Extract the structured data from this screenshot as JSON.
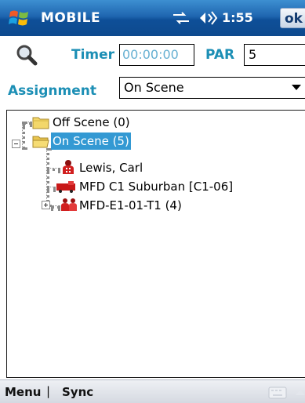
{
  "titlebar": {
    "title": "MOBILE",
    "time": "1:55",
    "ok_label": "ok",
    "icons": [
      "windows-start-icon",
      "connectivity-icon",
      "volume-icon"
    ]
  },
  "form": {
    "timer_label": "Timer",
    "timer_value": "00:00:00",
    "par_label": "PAR",
    "par_value": "5",
    "assignment_label": "Assignment",
    "assignment_value": "On Scene"
  },
  "tree": {
    "nodes": [
      {
        "label": "Off Scene (0)",
        "icon": "folder-icon",
        "depth": 0,
        "selected": false
      },
      {
        "label": "On Scene (5)",
        "icon": "folder-open-icon",
        "depth": 0,
        "selected": true,
        "expanded": true
      },
      {
        "label": "Lewis, Carl",
        "icon": "person-icon",
        "depth": 1,
        "selected": false
      },
      {
        "label": "MFD C1 Suburban [C1-06]",
        "icon": "vehicle-icon",
        "depth": 1,
        "selected": false
      },
      {
        "label": "MFD-E1-01-T1 (4)",
        "icon": "group-icon",
        "depth": 1,
        "selected": false,
        "expanded": false
      }
    ]
  },
  "menubar": {
    "left_label": "Menu",
    "separator": "|",
    "right_label": "Sync"
  },
  "colors": {
    "titlebar": "#1f66b0",
    "label_accent": "#1c8fb5",
    "selection": "#3399d3"
  }
}
